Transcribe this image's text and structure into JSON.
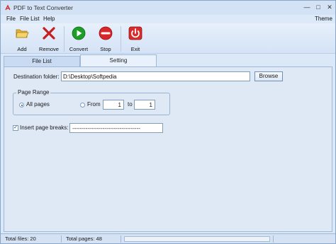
{
  "window": {
    "title": "PDF to Text Converter"
  },
  "menu": {
    "file": "File",
    "file_list": "File List",
    "help": "Help",
    "theme": "Theme"
  },
  "toolbar": {
    "add": "Add",
    "remove": "Remove",
    "convert": "Convert",
    "stop": "Stop",
    "exit": "Exit"
  },
  "tabs": {
    "file_list": "File List",
    "setting": "Setting"
  },
  "settings": {
    "destination_label": "Destination folder:",
    "destination_value": "D:\\Desktop\\Softpedia",
    "browse_label": "Browse",
    "page_range_label": "Page Range",
    "all_pages_label": "All pages",
    "from_label": "From",
    "from_value": "1",
    "to_label": "to",
    "to_value": "1",
    "insert_breaks_label": "Insert page breaks:",
    "insert_breaks_value": "------------------------------------"
  },
  "status": {
    "total_files": "Total files: 20",
    "total_pages": "Total pages: 48",
    "progress": 0
  },
  "colors": {
    "accent": "#dbe8f7",
    "convert": "#1f9d2a",
    "stop": "#d9262a",
    "remove": "#c81e1e"
  }
}
